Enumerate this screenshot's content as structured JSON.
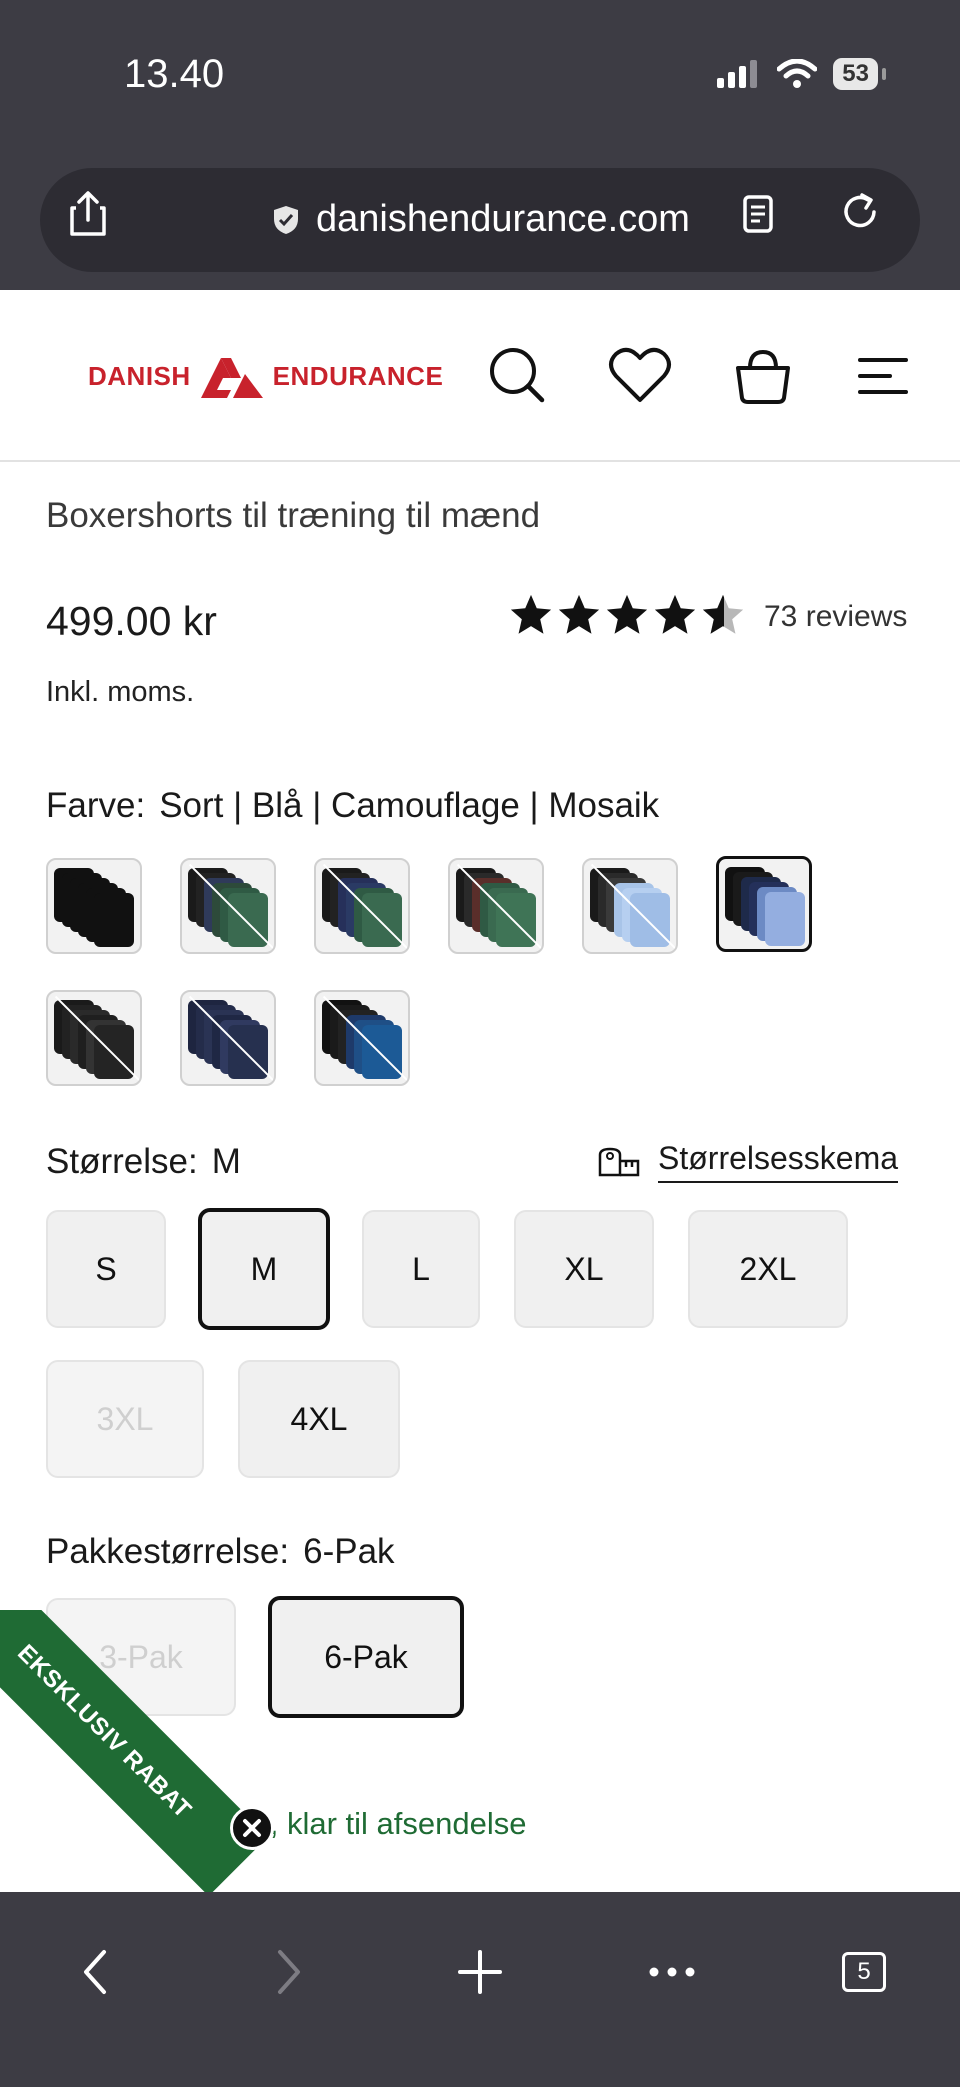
{
  "status_bar": {
    "time": "13.40",
    "battery": "53"
  },
  "browser": {
    "url": "danishendurance.com",
    "tab_count": "5"
  },
  "header": {
    "logo_left": "DANISH",
    "logo_right": "ENDURANCE"
  },
  "product": {
    "title": "Boxershorts til træning til mænd",
    "price": "499.00 kr",
    "vat_note": "Inkl. moms.",
    "rating": 4.5,
    "reviews": "73 reviews"
  },
  "color": {
    "label": "Farve:",
    "value": "Sort | Blå | Camouflage | Mosaik",
    "swatches": [
      {
        "name": "black-6",
        "available": true,
        "selected": false
      },
      {
        "name": "black-blue-green",
        "available": false,
        "selected": false
      },
      {
        "name": "black-navy-green",
        "available": false,
        "selected": false
      },
      {
        "name": "black-green",
        "available": false,
        "selected": false
      },
      {
        "name": "black-mosaic",
        "available": false,
        "selected": false
      },
      {
        "name": "black-blue-mosaic",
        "available": true,
        "selected": true
      },
      {
        "name": "black-mixed",
        "available": false,
        "selected": false
      },
      {
        "name": "navy",
        "available": false,
        "selected": false
      },
      {
        "name": "black-blue",
        "available": false,
        "selected": false
      }
    ]
  },
  "size": {
    "label": "Størrelse:",
    "value": "M",
    "guide_label": "Størrelsesskema",
    "options": [
      {
        "label": "S",
        "state": "available"
      },
      {
        "label": "M",
        "state": "selected"
      },
      {
        "label": "L",
        "state": "available"
      },
      {
        "label": "XL",
        "state": "available"
      },
      {
        "label": "2XL",
        "state": "available"
      },
      {
        "label": "3XL",
        "state": "disabled"
      },
      {
        "label": "4XL",
        "state": "available"
      }
    ]
  },
  "pack": {
    "label": "Pakkestørrelse:",
    "value": "6-Pak",
    "options": [
      {
        "label": "3-Pak",
        "state": "disabled"
      },
      {
        "label": "6-Pak",
        "state": "selected"
      }
    ]
  },
  "stock": {
    "text": "På lager, klar til afsendelse"
  },
  "ribbon": {
    "text": "EKSKLUSIV RABAT"
  },
  "colors": {
    "brand_red": "#c8222c",
    "stock_green": "#1f6b34",
    "chrome_bg": "#3d3c44"
  }
}
